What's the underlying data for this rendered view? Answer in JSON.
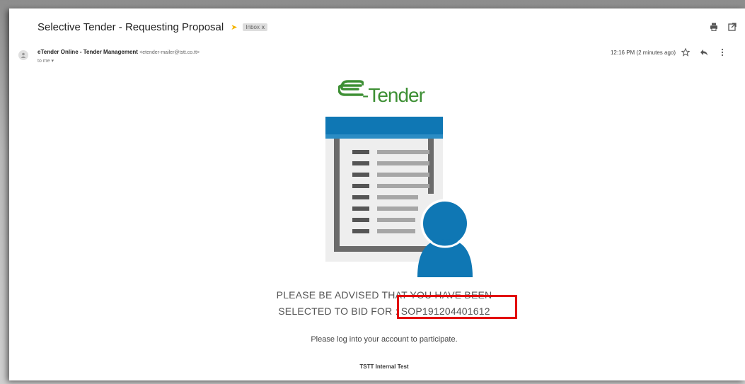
{
  "email": {
    "subject": "Selective Tender - Requesting Proposal",
    "label": "Inbox",
    "label_close": "x",
    "sender_name": "eTender Online - Tender Management",
    "sender_email": "<etender-mailer@tstt.co.tt>",
    "recipient": "to me",
    "timestamp": "12:16 PM (2 minutes ago)"
  },
  "logo": {
    "text": "-Tender"
  },
  "body": {
    "line1": "PLEASE BE ADVISED THAT YOU HAVE BEEN",
    "line2_prefix": "SELECTED TO BID FOR",
    "reference": ": SOP191204401612",
    "instruction": "Please log into your account to participate.",
    "footer": "TSTT Internal Test"
  },
  "colors": {
    "brand_green": "#3d8f34",
    "illustration_blue": "#0f77b4",
    "highlight_red": "#e20000"
  }
}
